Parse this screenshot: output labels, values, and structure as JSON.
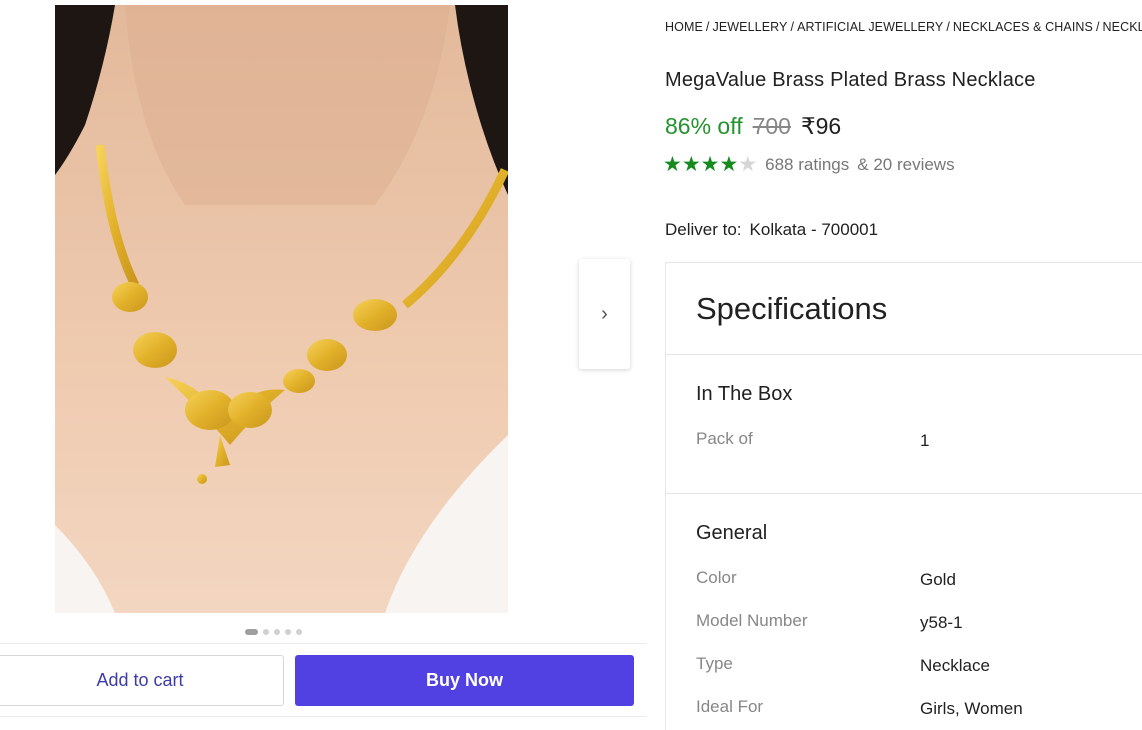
{
  "breadcrumb": {
    "items": [
      "HOME",
      "JEWELLERY",
      "ARTIFICIAL JEWELLERY",
      "NECKLACES & CHAINS",
      "NECKL"
    ],
    "separator": "/"
  },
  "product": {
    "title": "MegaValue Brass Plated Brass Necklace",
    "discount": "86% off",
    "mrp": "700",
    "price": "₹96",
    "rating": {
      "stars_filled": 4,
      "stars_total": 5,
      "ratings_text": "688 ratings",
      "reviews_text": "& 20 reviews"
    }
  },
  "delivery": {
    "label": "Deliver to:",
    "location": "Kolkata - 700001"
  },
  "gallery": {
    "dot_count": 5,
    "active_dot": 0,
    "next_icon": "chevron-right-icon",
    "next_glyph": "›"
  },
  "actions": {
    "add_to_cart": "Add to cart",
    "buy_now": "Buy Now"
  },
  "specifications": {
    "heading": "Specifications",
    "in_the_box": {
      "title": "In The Box",
      "rows": [
        {
          "key": "Pack of",
          "value": "1"
        }
      ]
    },
    "general": {
      "title": "General",
      "rows": [
        {
          "key": "Color",
          "value": "Gold"
        },
        {
          "key": "Model Number",
          "value": "y58-1"
        },
        {
          "key": "Type",
          "value": "Necklace"
        },
        {
          "key": "Ideal For",
          "value": "Girls, Women"
        }
      ]
    }
  },
  "colors": {
    "discount_green": "#25932e",
    "star_green": "#168a1e",
    "buy_now_bg": "#5141e3",
    "cart_text": "#3e3ca8"
  }
}
